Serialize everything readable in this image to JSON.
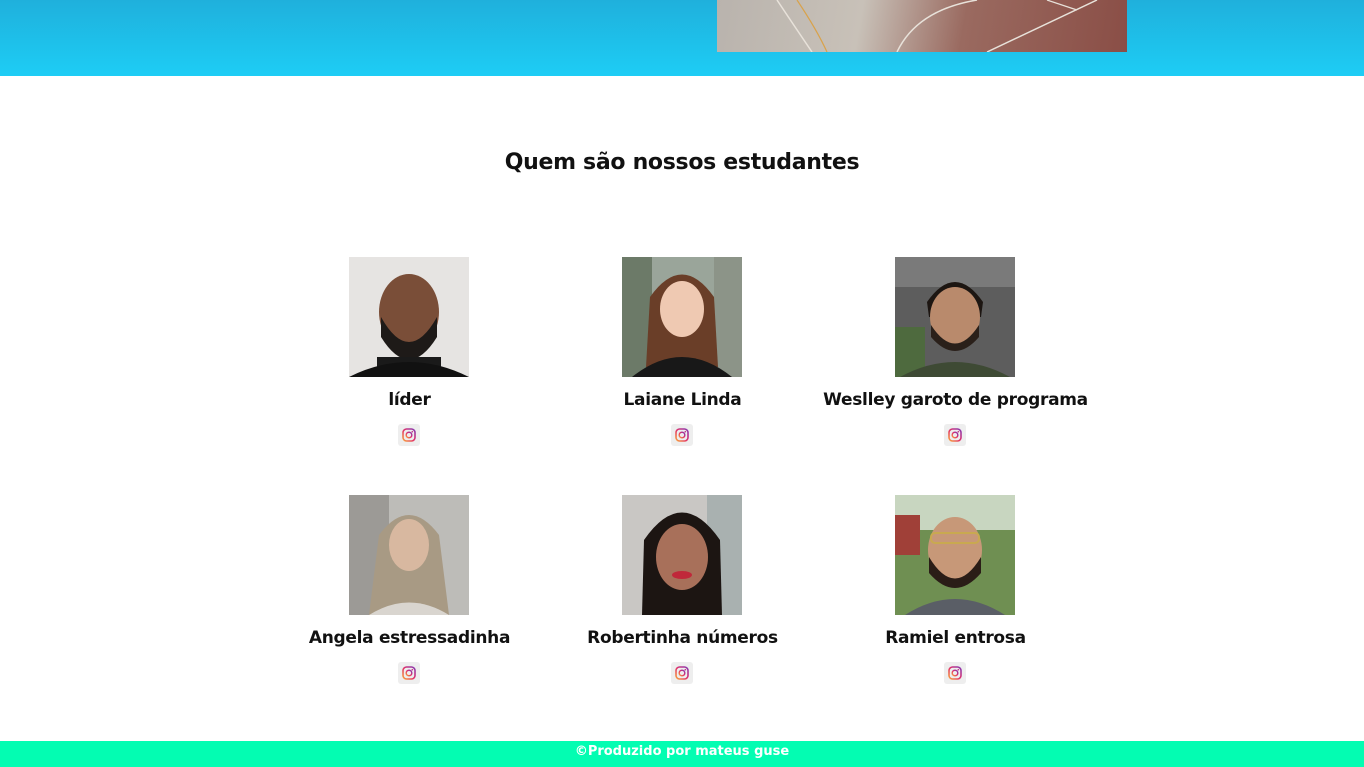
{
  "hero": {
    "image_icon": "court-photo"
  },
  "section": {
    "title": "Quem são nossos estudantes"
  },
  "students": [
    {
      "name": "líder",
      "photo_icon": "student-photo",
      "social_icon": "instagram-icon"
    },
    {
      "name": "Laiane Linda",
      "photo_icon": "student-photo",
      "social_icon": "instagram-icon"
    },
    {
      "name": "Weslley garoto de programa",
      "photo_icon": "student-photo",
      "social_icon": "instagram-icon"
    },
    {
      "name": "Angela estressadinha",
      "photo_icon": "student-photo",
      "social_icon": "instagram-icon"
    },
    {
      "name": "Robertinha números",
      "photo_icon": "student-photo",
      "social_icon": "instagram-icon"
    },
    {
      "name": "Ramiel entrosa",
      "photo_icon": "student-photo",
      "social_icon": "instagram-icon"
    }
  ],
  "footer": {
    "text": "©Produzido por mateus guse"
  },
  "colors": {
    "hero_top": "#1fb0dc",
    "hero_bottom": "#1ecdf5",
    "footer": "#03fdb2",
    "text": "#111111"
  }
}
